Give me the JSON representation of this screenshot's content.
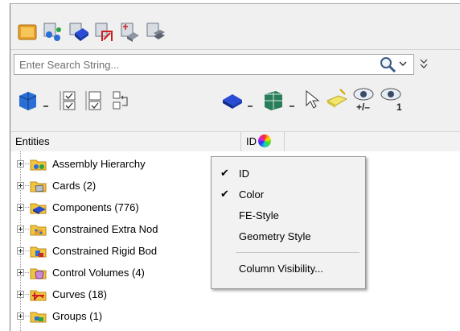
{
  "toolbar_top": {
    "icons": [
      "model-view-icon",
      "connectivity-view-icon",
      "component-view-icon",
      "loadcase-view-icon",
      "entity-state-view-icon",
      "include-view-icon"
    ]
  },
  "search": {
    "placeholder": "Enter Search String..."
  },
  "toolbar_second": {
    "icons": [
      "entity-display-icon",
      "show-all-icon",
      "show-selected-icon",
      "reverse-selection-icon",
      "shaded-display-icon",
      "wireframe-display-icon",
      "select-cursor-icon",
      "clear-selection-icon",
      "isolate-show-icon",
      "isolate-only-icon"
    ],
    "eye_labels": [
      "+/–",
      "1"
    ]
  },
  "columns": {
    "entities": "Entities",
    "id": "ID"
  },
  "tree": [
    {
      "label": "Assembly Hierarchy",
      "icon": "assembly-folder-icon"
    },
    {
      "label": "Cards (2)",
      "icon": "cards-folder-icon"
    },
    {
      "label": "Components (776)",
      "icon": "components-folder-icon"
    },
    {
      "label": "Constrained Extra Nod",
      "icon": "constrained-extra-nodes-folder-icon"
    },
    {
      "label": "Constrained Rigid Bod",
      "icon": "constrained-rigid-bodies-folder-icon"
    },
    {
      "label": "Control Volumes (4)",
      "icon": "control-volumes-folder-icon"
    },
    {
      "label": "Curves (18)",
      "icon": "curves-folder-icon"
    },
    {
      "label": "Groups (1)",
      "icon": "groups-folder-icon"
    }
  ],
  "context_menu": {
    "items": [
      {
        "label": "ID",
        "checked": true,
        "check": "✔"
      },
      {
        "label": "Color",
        "checked": true,
        "check": "✔"
      },
      {
        "label": "FE-Style",
        "checked": false,
        "check": ""
      },
      {
        "label": "Geometry Style",
        "checked": false,
        "check": ""
      },
      {
        "label": "Column Visibility...",
        "checked": false,
        "check": ""
      }
    ]
  },
  "colors": {
    "folder": "#f3c53d",
    "blue_accent": "#1f3fbf"
  }
}
